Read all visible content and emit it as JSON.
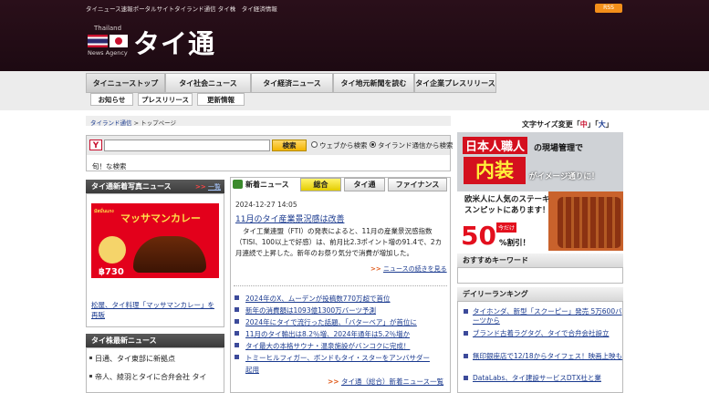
{
  "header": {
    "tagline": "タイニュース速報ポータルサイトタイランド通信 タイ株　タイ経済情報",
    "rss_label": "RSS",
    "logo_small_top": "Thailand",
    "logo_small_bottom": "News Agency",
    "logo_text": "タイ通"
  },
  "nav": {
    "main_tabs": [
      {
        "label": "タイニューストップ"
      },
      {
        "label": "タイ社会ニュース"
      },
      {
        "label": "タイ経済ニュース"
      },
      {
        "label": "タイ地元新聞を読む"
      },
      {
        "label": "タイ企業プレスリリース"
      }
    ],
    "sub_tabs": [
      {
        "label": "お知らせ"
      },
      {
        "label": "プレスリリース"
      },
      {
        "label": "更新情報"
      }
    ]
  },
  "breadcrumb": {
    "home": "タイランド通信",
    "sep": ">",
    "current": "トップページ"
  },
  "font_size": {
    "label": "文字サイズ変更「",
    "small": "中",
    "mid": "」「",
    "large": "大",
    "end": "」"
  },
  "search": {
    "placeholder": "",
    "button_label": "検索",
    "option_web": "ウェブから検索",
    "option_site": "タイランド通信から検索",
    "selected": "site",
    "sub_label": "旬！な検索"
  },
  "photo_news": {
    "heading": "タイ通新着写真ニュース",
    "more_arrows": ">>",
    "more_label": "一覧",
    "ad_brand": "มัสมั่นแกง",
    "ad_title": "マッサマンカレー",
    "ad_price": "฿730",
    "caption": "松屋、タイ料理「マッサマンカレー」を再販"
  },
  "stock_news": {
    "heading": "タイ株最新ニュース",
    "items": [
      {
        "text": "日通、タイ東部に新拠点"
      },
      {
        "text": "帝人、綾羽とタイに合弁会社 タイ"
      }
    ]
  },
  "news": {
    "section_label": "新着ニュース",
    "tabs": [
      {
        "label": "総合",
        "active": true
      },
      {
        "label": "タイ通",
        "active": false
      },
      {
        "label": "ファイナンス",
        "active": false
      }
    ],
    "date": "2024-12-27 14:05",
    "headline": "11月のタイ産業景況感は改善",
    "body": "タイ工業連盟（FTI）の発表によると、11月の産業景況感指数（TISI、100以上で好感）は、前月比2.3ポイント増の91.4で、2カ月連続で上昇した。新年のお祭り気分で消費が増加した。",
    "more_arrows": ">>",
    "more_label": "ニュースの続きを見る",
    "list": [
      {
        "text": "2024年のX、ムーデンが投稿数770万超で首位"
      },
      {
        "text": "新年の消費額は1093億1300万バーツ予測"
      },
      {
        "text": "2024年にタイで流行った話題、「バターベア」が首位に"
      },
      {
        "text": "11月のタイ輸出は8.2％増、2024年通年は5.2％増か"
      },
      {
        "text": "タイ最大の本格サウナ・温泉施設がバンコクに完成！"
      },
      {
        "text": "トミーヒルフィガー、ボンドもタイ・スターをアンバサダー"
      },
      {
        "text": "起用"
      }
    ],
    "list_more_arrows": ">>",
    "list_more_label": "タイ通（総合）新着ニュース一覧"
  },
  "ads": {
    "ad1_pre": "日本人",
    "ad1_craft": "職人",
    "ad1_line1_rest": "の現場管理で",
    "ad1_big": "内装",
    "ad1_line2": "がイメージ通りに！",
    "ad2_line1": "欧米人に人気のステーキ",
    "ad2_line2": "スンピットにあります！",
    "ad2_today": "今だけ",
    "ad2_pct": "50",
    "ad2_pct_label": "%割引！"
  },
  "keywords": {
    "heading": "おすすめキーワード"
  },
  "ranking": {
    "heading": "デイリーランキング",
    "items": [
      {
        "text": "タイホンダ、新型「スクーピー」発売 5万600バーツから"
      },
      {
        "text": "ブランド古着ラグタグ、タイで合弁会社設立"
      },
      {
        "text": "無印銀座店で12/18からタイフェス！映画上映も"
      },
      {
        "text": "DataLabs、タイ建設サービスDTX社と業"
      }
    ]
  }
}
